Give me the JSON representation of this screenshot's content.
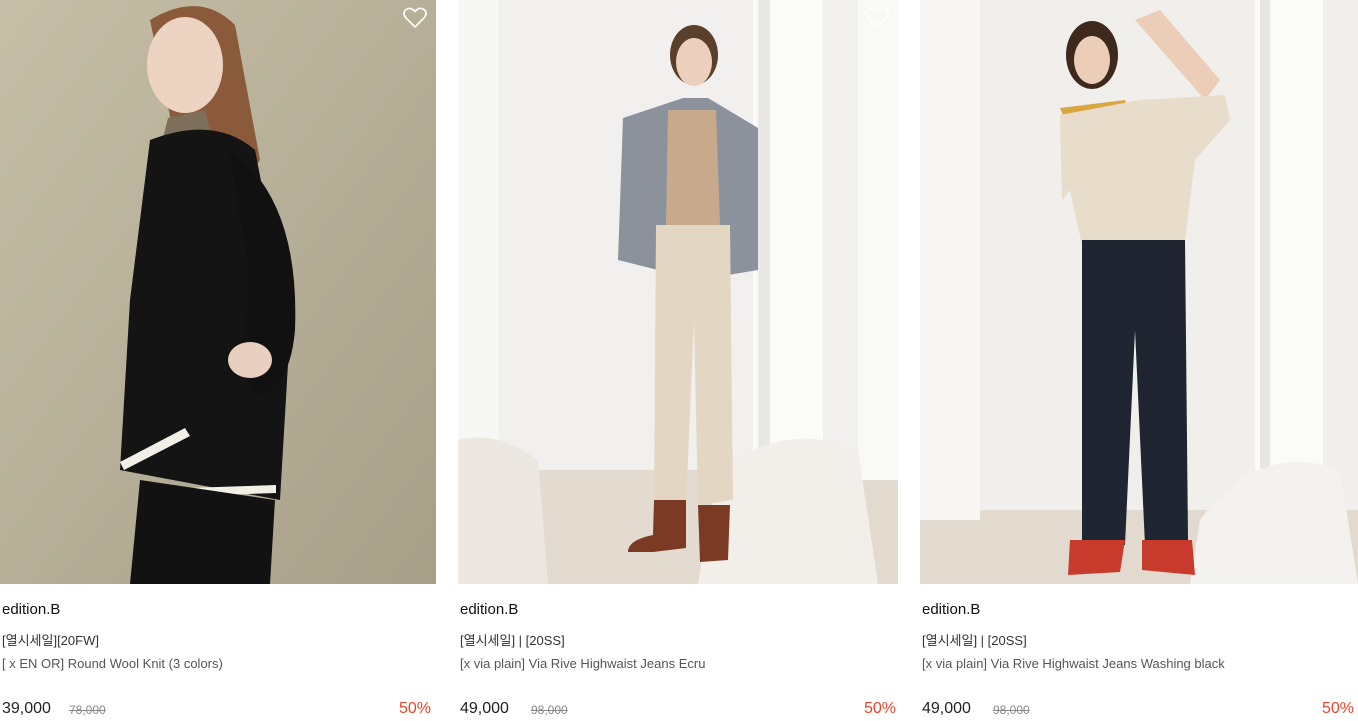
{
  "products": [
    {
      "brand": "edition.B",
      "tag": "[열시세일][20FW]",
      "name": "[ x EN OR] Round Wool Knit (3 colors)",
      "price": "39,000",
      "original_price": "78,000",
      "discount": "50%",
      "image": "model-in-black-knit-photo"
    },
    {
      "brand": "edition.B",
      "tag": "[열시세일] | [20SS]",
      "name": "[x via plain] Via Rive Highwaist Jeans Ecru",
      "price": "49,000",
      "original_price": "98,000",
      "discount": "50%",
      "image": "model-in-ecru-jeans-photo"
    },
    {
      "brand": "edition.B",
      "tag": "[열시세일] | [20SS]",
      "name": "[x via plain] Via Rive Highwaist Jeans Washing black",
      "price": "49,000",
      "original_price": "98,000",
      "discount": "50%",
      "image": "model-in-black-jeans-photo"
    }
  ],
  "icons": {
    "wishlist": "heart-outline-icon"
  },
  "colors": {
    "discount": "#e8462c",
    "background": "#ffffff"
  }
}
